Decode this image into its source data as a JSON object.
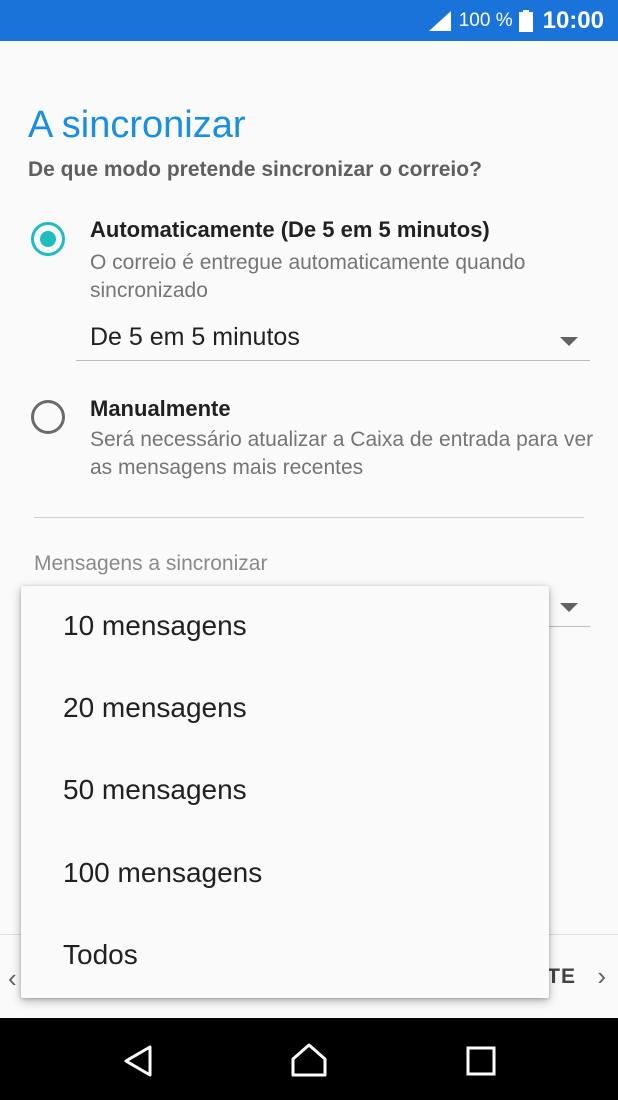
{
  "status_bar": {
    "battery_percent": "100 %",
    "time": "10:00"
  },
  "page": {
    "title": "A sincronizar",
    "subtitle": "De que modo pretende sincronizar o correio?"
  },
  "sync_options": [
    {
      "title": "Automaticamente (De 5 em 5 minutos)",
      "description": "O correio é entregue automaticamente quando sincronizado",
      "selected": true
    },
    {
      "title": "Manualmente",
      "description": "Será necessário atualizar a Caixa de entrada para ver as mensagens mais recentes",
      "selected": false
    }
  ],
  "interval_spinner": {
    "value": "De 5 em 5 minutos"
  },
  "messages_section": {
    "label": "Mensagens a sincronizar"
  },
  "dropdown": {
    "items": [
      "10 mensagens",
      "20 mensagens",
      "50 mensagens",
      "100 mensagens",
      "Todos"
    ]
  },
  "bottom_bar": {
    "next_label": "TE"
  },
  "colors": {
    "accent": "#1fbdbd",
    "title": "#1a8fe0",
    "status_bar": "#1a73d9"
  }
}
